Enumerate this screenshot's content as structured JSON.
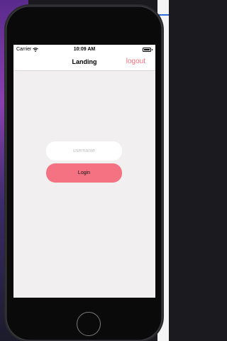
{
  "status_bar": {
    "carrier": "Carrier",
    "time": "10:09 AM"
  },
  "nav_bar": {
    "title": "Landing",
    "logout_label": "logout"
  },
  "form": {
    "username_placeholder": "username",
    "username_value": "",
    "login_label": "Login"
  },
  "colors": {
    "accent": "#f47282",
    "logout_text": "#f36f7c",
    "screen_bg": "#f2eff0"
  },
  "icons": {
    "wifi": "wifi-icon",
    "battery": "battery-icon",
    "home": "home-button"
  }
}
